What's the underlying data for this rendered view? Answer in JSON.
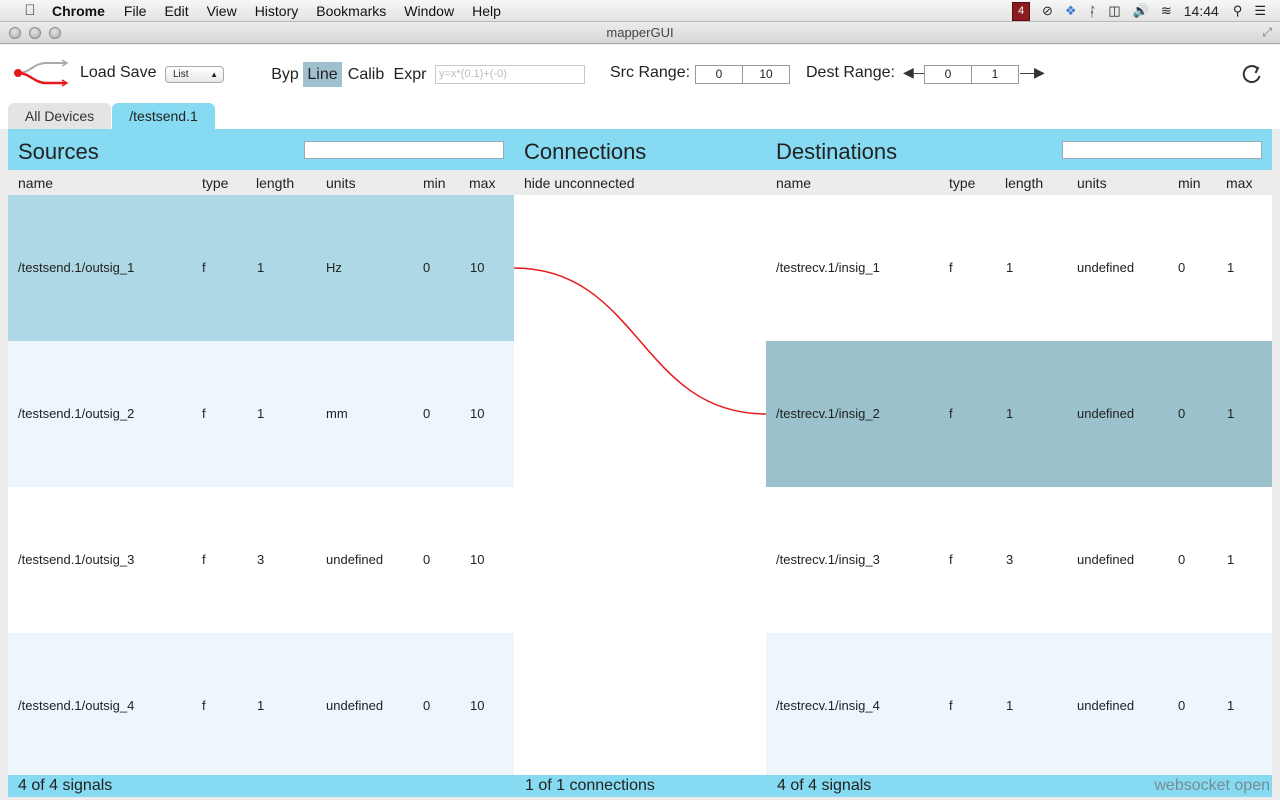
{
  "menubar": {
    "app": "Chrome",
    "items": [
      "File",
      "Edit",
      "View",
      "History",
      "Bookmarks",
      "Window",
      "Help"
    ],
    "badge": "4",
    "clock": "14:44"
  },
  "window": {
    "title": "mapperGUI"
  },
  "toolbar": {
    "load_label": "Load",
    "save_label": "Save",
    "view_select": "List",
    "modes": [
      "Byp",
      "Line",
      "Calib",
      "Expr"
    ],
    "active_mode": "Line",
    "expr_placeholder": "y=x*(0.1)+(-0)",
    "src_range_label": "Src Range:",
    "src_min": "0",
    "src_max": "10",
    "dest_range_label": "Dest Range:",
    "dest_min": "0",
    "dest_max": "1"
  },
  "tabs": [
    {
      "label": "All Devices",
      "active": false
    },
    {
      "label": "/testsend.1",
      "active": true
    }
  ],
  "sources": {
    "title": "Sources",
    "columns": [
      "name",
      "type",
      "length",
      "units",
      "min",
      "max"
    ],
    "rows": [
      {
        "name": "/testsend.1/outsig_1",
        "type": "f",
        "length": "1",
        "units": "Hz",
        "min": "0",
        "max": "10"
      },
      {
        "name": "/testsend.1/outsig_2",
        "type": "f",
        "length": "1",
        "units": "mm",
        "min": "0",
        "max": "10"
      },
      {
        "name": "/testsend.1/outsig_3",
        "type": "f",
        "length": "3",
        "units": "undefined",
        "min": "0",
        "max": "10"
      },
      {
        "name": "/testsend.1/outsig_4",
        "type": "f",
        "length": "1",
        "units": "undefined",
        "min": "0",
        "max": "10"
      }
    ],
    "footer": "4 of 4 signals"
  },
  "connections": {
    "title": "Connections",
    "subheader": "hide unconnected",
    "footer": "1 of 1 connections",
    "line_color": "#e8191b"
  },
  "destinations": {
    "title": "Destinations",
    "columns": [
      "name",
      "type",
      "length",
      "units",
      "min",
      "max"
    ],
    "rows": [
      {
        "name": "/testrecv.1/insig_1",
        "type": "f",
        "length": "1",
        "units": "undefined",
        "min": "0",
        "max": "1"
      },
      {
        "name": "/testrecv.1/insig_2",
        "type": "f",
        "length": "1",
        "units": "undefined",
        "min": "0",
        "max": "1"
      },
      {
        "name": "/testrecv.1/insig_3",
        "type": "f",
        "length": "3",
        "units": "undefined",
        "min": "0",
        "max": "1"
      },
      {
        "name": "/testrecv.1/insig_4",
        "type": "f",
        "length": "1",
        "units": "undefined",
        "min": "0",
        "max": "1"
      }
    ],
    "footer": "4 of 4 signals"
  },
  "status": {
    "websocket": "websocket open"
  },
  "colors": {
    "accent": "#86dbf2",
    "selected_source": "#aed8e5",
    "selected_destination": "#9bc1cd",
    "alt_row": "#edf5fd"
  }
}
